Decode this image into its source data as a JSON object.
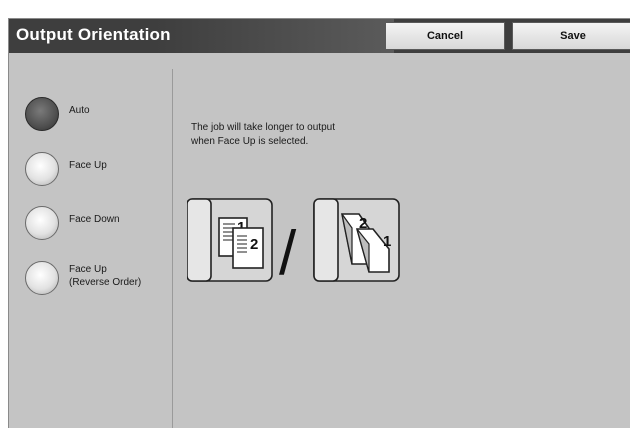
{
  "header": {
    "title": "Output Orientation",
    "cancel_label": "Cancel",
    "save_label": "Save"
  },
  "options": [
    {
      "label": "Auto",
      "selected": true
    },
    {
      "label": "Face Up",
      "selected": false
    },
    {
      "label": "Face Down",
      "selected": false
    },
    {
      "label": "Face Up",
      "label2": "(Reverse Order)",
      "selected": false
    }
  ],
  "message": {
    "line1": "The job will take longer to output",
    "line2": "when Face Up is selected."
  },
  "illustration": {
    "left_numbers": [
      "1",
      "2"
    ],
    "right_numbers": [
      "2",
      "1"
    ],
    "separator": "/"
  },
  "colors": {
    "title_bar": "#3e3e3e",
    "panel_bg": "#c4c4c4",
    "selected_radio": "#505050"
  }
}
